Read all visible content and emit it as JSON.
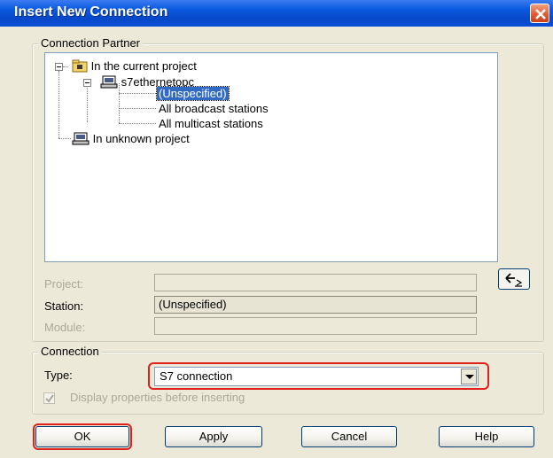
{
  "window": {
    "title": "Insert New Connection"
  },
  "connection_partner": {
    "group_label": "Connection Partner",
    "tree": [
      {
        "label": "In the current project",
        "icon": "folder-project-icon"
      },
      {
        "label": "s7ethernetopc",
        "icon": "station-icon"
      },
      {
        "label": "(Unspecified)",
        "selected": true
      },
      {
        "label": "All broadcast stations"
      },
      {
        "label": "All multicast stations"
      },
      {
        "label": "In unknown project",
        "icon": "station-icon"
      }
    ],
    "project_label": "Project:",
    "project_value": "",
    "station_label": "Station:",
    "station_value": "(Unspecified)",
    "module_label": "Module:",
    "module_value": ""
  },
  "connection": {
    "group_label": "Connection",
    "type_label": "Type:",
    "type_value": "S7 connection",
    "display_properties_label": "Display properties before inserting",
    "display_properties_checked": true
  },
  "buttons": {
    "ok": "OK",
    "apply": "Apply",
    "cancel": "Cancel",
    "help": "Help"
  },
  "colors": {
    "title_bar": "#0a5ae0",
    "selection": "#316ac5",
    "highlight_outline": "#e0201a"
  }
}
